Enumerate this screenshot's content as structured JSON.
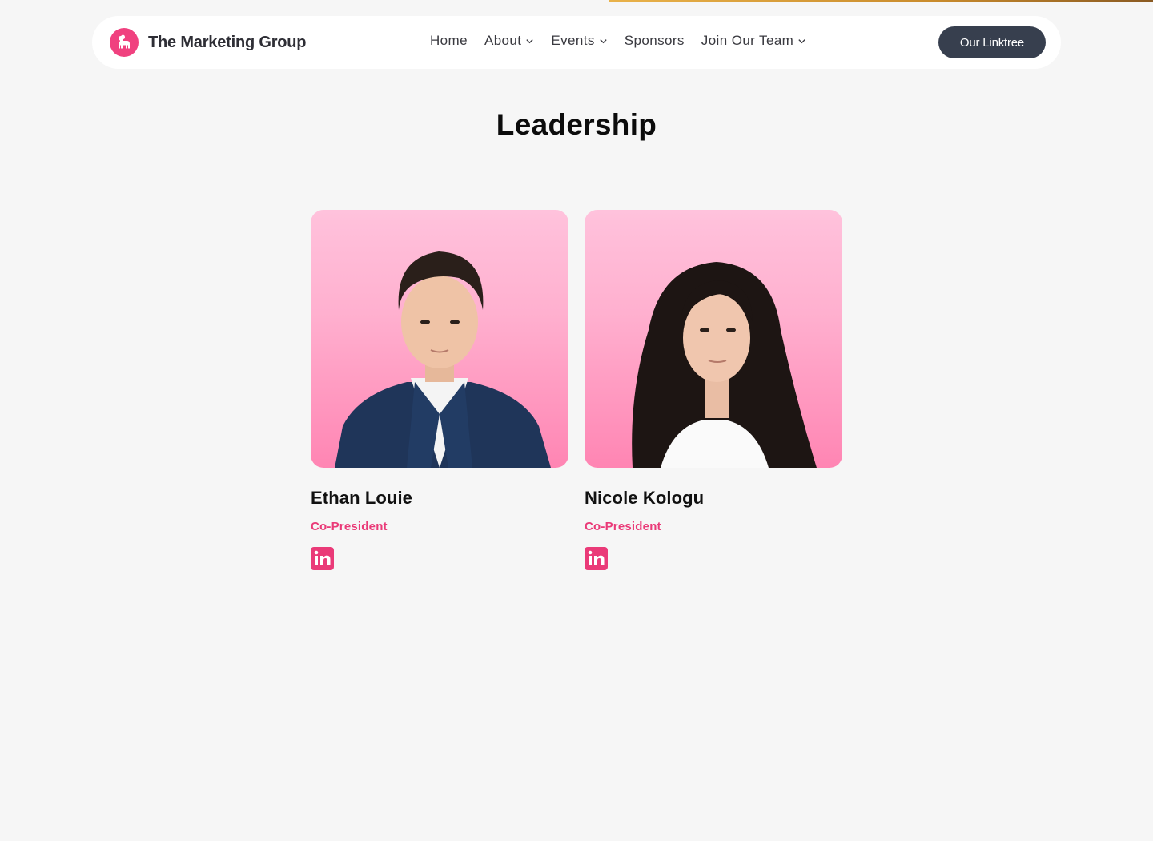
{
  "nav": {
    "brand_name": "The Marketing Group",
    "links": [
      {
        "label": "Home",
        "has_dropdown": false
      },
      {
        "label": "About",
        "has_dropdown": true
      },
      {
        "label": "Events",
        "has_dropdown": true
      },
      {
        "label": "Sponsors",
        "has_dropdown": false
      },
      {
        "label": "Join Our Team",
        "has_dropdown": true
      }
    ],
    "cta_label": "Our Linktree"
  },
  "section": {
    "title": "Leadership"
  },
  "members": [
    {
      "name": "Ethan Louie",
      "role": "Co-President",
      "icon": "linkedin-icon"
    },
    {
      "name": "Nicole Kologu",
      "role": "Co-President",
      "icon": "linkedin-icon"
    }
  ],
  "colors": {
    "accent": "#ea3a78",
    "logo": "#f0417f",
    "cta_bg": "#373f4e",
    "background": "#f6f6f6"
  }
}
